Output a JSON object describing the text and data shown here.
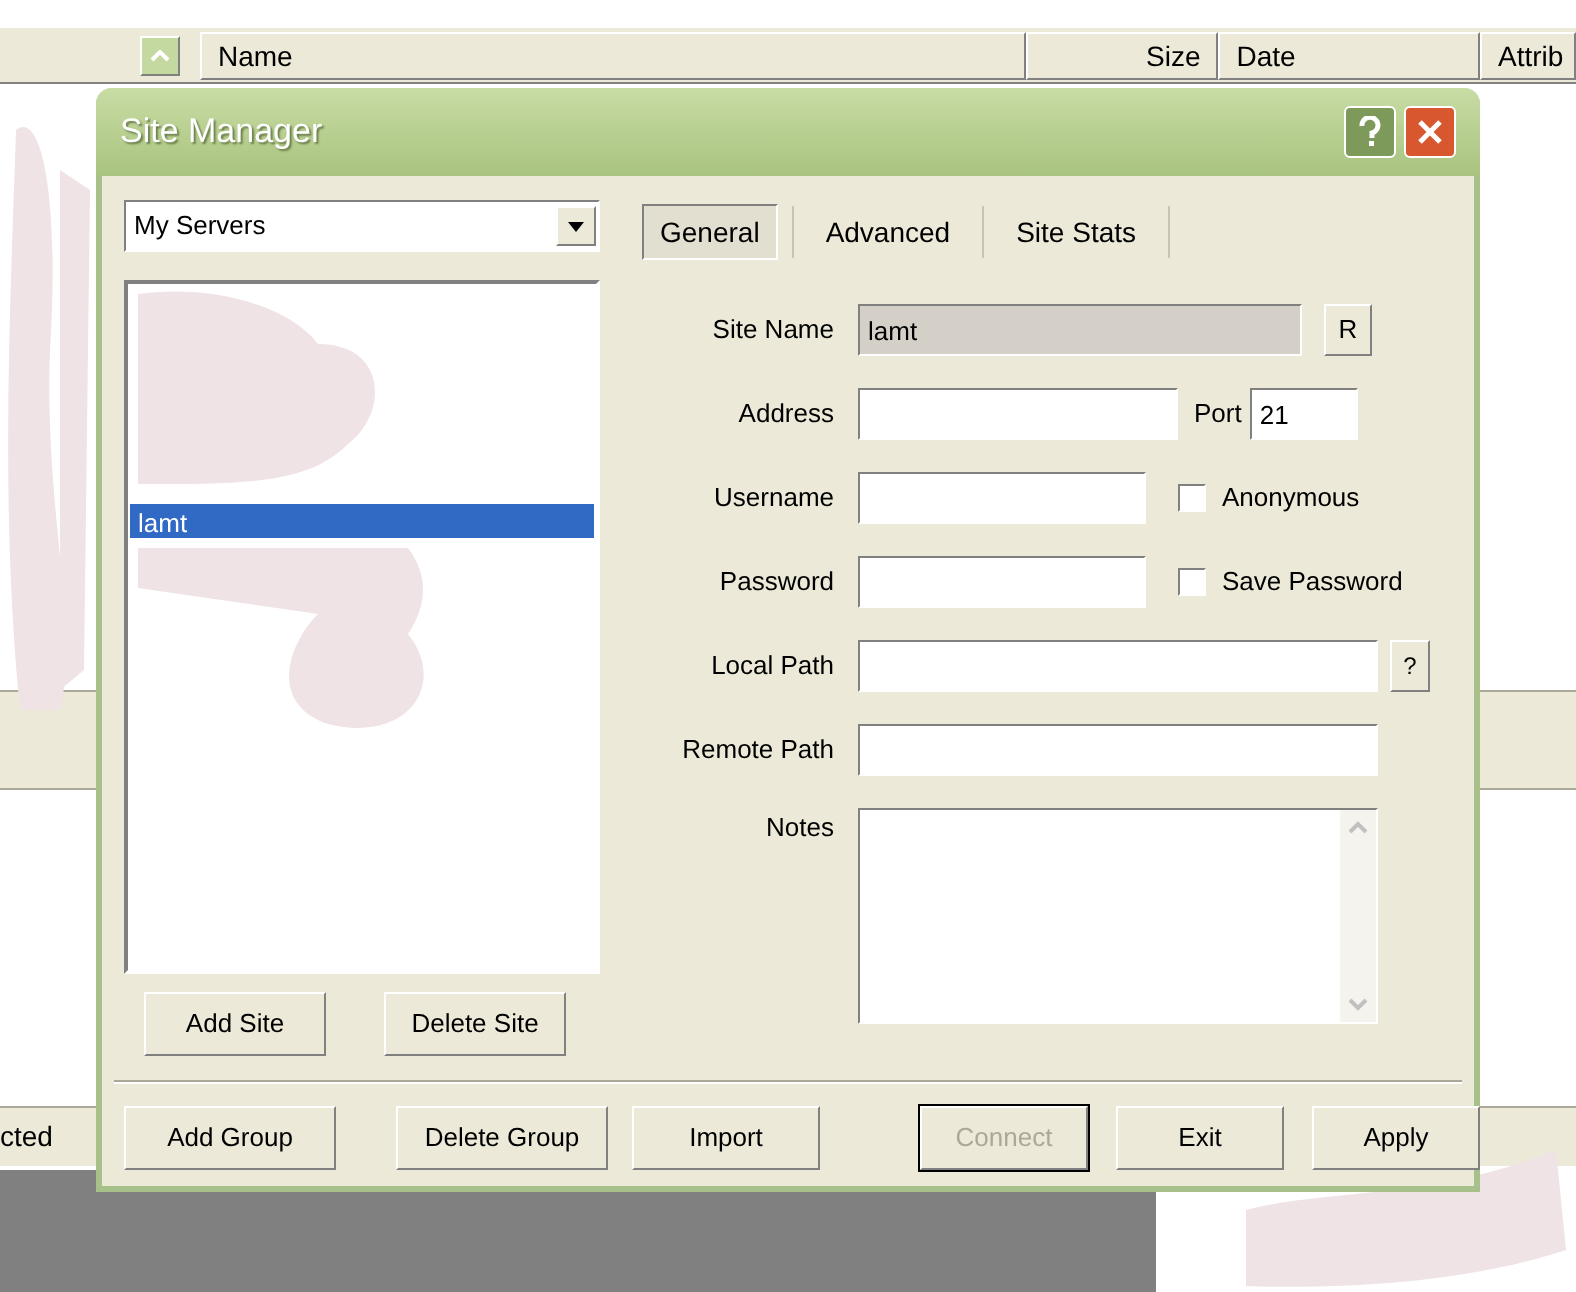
{
  "background": {
    "columns": [
      "Name",
      "Size",
      "Date",
      "Attrib"
    ],
    "status_text": "cted"
  },
  "window": {
    "title": "Site Manager"
  },
  "group_select": {
    "value": "My Servers"
  },
  "sites": [
    {
      "label": "lamt",
      "selected": true
    }
  ],
  "site_buttons": [
    {
      "label": "Add Site"
    },
    {
      "label": "Delete Site"
    }
  ],
  "tabs": [
    {
      "label": "General",
      "selected": true
    },
    {
      "label": "Advanced",
      "selected": false
    },
    {
      "label": "Site Stats",
      "selected": false
    }
  ],
  "form": {
    "site_name": {
      "label": "Site Name",
      "value": "lamt",
      "button": "R"
    },
    "address": {
      "label": "Address"
    },
    "port": {
      "label": "Port",
      "value": "21"
    },
    "username": {
      "label": "Username"
    },
    "anonymous": {
      "label": "Anonymous",
      "checked": false
    },
    "password": {
      "label": "Password"
    },
    "save_password": {
      "label": "Save Password",
      "checked": false
    },
    "local_path": {
      "label": "Local Path",
      "button": "?"
    },
    "remote_path": {
      "label": "Remote Path"
    },
    "notes": {
      "label": "Notes"
    }
  },
  "bottom_buttons": [
    {
      "label": "Add Group",
      "disabled": false
    },
    {
      "label": "Delete Group",
      "disabled": false
    },
    {
      "label": "Import",
      "disabled": false
    },
    {
      "label": "Connect",
      "disabled": true
    },
    {
      "label": "Exit",
      "disabled": false
    },
    {
      "label": "Apply",
      "disabled": false
    }
  ]
}
